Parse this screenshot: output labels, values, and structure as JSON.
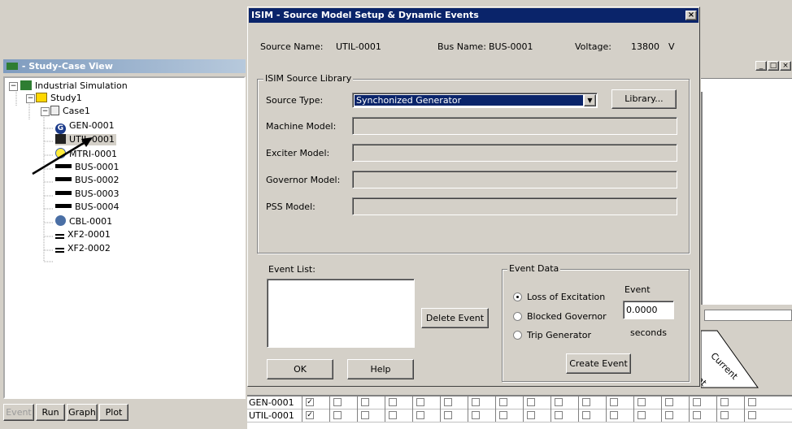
{
  "left_window": {
    "title": " - Study-Case View",
    "tree": [
      {
        "label": "Industrial Simulation",
        "icon": "app-logo-icon"
      },
      {
        "label": "Study1",
        "icon": "folder-icon"
      },
      {
        "label": "Case1",
        "icon": "case-icon"
      },
      {
        "label": "GEN-0001",
        "icon": "generator-icon"
      },
      {
        "label": "UTIL-0001",
        "icon": "utility-icon"
      },
      {
        "label": "MTRI-0001",
        "icon": "motor-icon"
      },
      {
        "label": "BUS-0001",
        "icon": "bus-icon"
      },
      {
        "label": "BUS-0002",
        "icon": "bus-icon"
      },
      {
        "label": "BUS-0003",
        "icon": "bus-icon"
      },
      {
        "label": "BUS-0004",
        "icon": "bus-icon"
      },
      {
        "label": "CBL-0001",
        "icon": "cable-icon"
      },
      {
        "label": "XF2-0001",
        "icon": "transformer-icon"
      },
      {
        "label": "XF2-0002",
        "icon": "transformer-icon"
      }
    ],
    "buttons": {
      "event": "Event",
      "run": "Run",
      "graph": "Graph",
      "plot": "Plot"
    }
  },
  "dialog": {
    "title": "ISIM - Source Model Setup & Dynamic Events",
    "source_name_label": "Source Name:",
    "source_name": "UTIL-0001",
    "bus_name_label": "Bus Name:",
    "bus_name": "BUS-0001",
    "voltage_label": "Voltage:",
    "voltage": "13800",
    "voltage_unit": "V",
    "library_group": "ISIM Source Library",
    "source_type_label": "Source Type:",
    "source_type": "Synchonized Generator",
    "library_button": "Library...",
    "machine_model_label": "Machine Model:",
    "exciter_model_label": "Exciter Model:",
    "governor_model_label": "Governor Model:",
    "pss_model_label": "PSS Model:",
    "event_list_label": "Event List:",
    "delete_event": "Delete Event",
    "event_data_group": "Event Data",
    "radios": [
      "Loss of Excitation",
      "Blocked Governor",
      "Trip Generator"
    ],
    "event_label": "Event",
    "event_value": "0.0000",
    "seconds_label": "seconds",
    "create_event": "Create Event",
    "ok": "OK",
    "help": "Help"
  },
  "grid": {
    "rows": [
      {
        "name": "GEN-0001",
        "checked_first": true
      },
      {
        "name": "UTIL-0001",
        "checked_first": true
      }
    ],
    "rotated_text": "Current",
    "rotated_text2": "nt"
  },
  "colors": {
    "titlebar": "#0a246a",
    "selection": "#0a246a",
    "face": "#d4d0c8"
  }
}
